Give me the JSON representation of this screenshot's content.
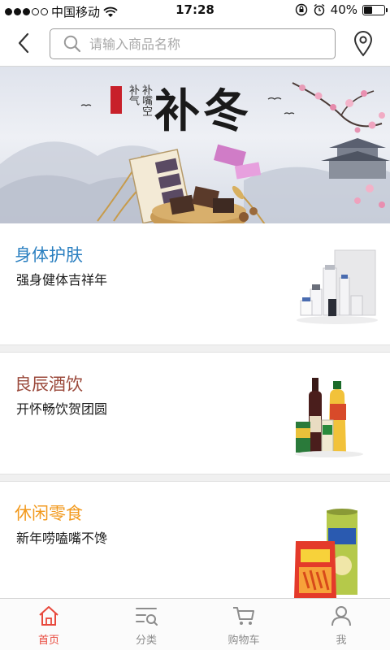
{
  "status_bar": {
    "carrier": "中国移动",
    "time": "17:28",
    "battery": "40%",
    "battery_level": 0.4
  },
  "header": {
    "search_placeholder": "请输入商品名称",
    "icons": [
      "back-arrow-icon",
      "search-icon",
      "location-pin-icon"
    ]
  },
  "banner": {
    "title": "补冬",
    "sub1": "补气",
    "sub2": "补嘴空"
  },
  "categories": [
    {
      "title": "身体护肤",
      "desc": "强身健体吉祥年",
      "color": "#2a7fc0"
    },
    {
      "title": "良辰酒饮",
      "desc": "开怀畅饮贺团圆",
      "color": "#9b4a3c"
    },
    {
      "title": "休闲零食",
      "desc": "新年唠嗑嘴不馋",
      "color": "#f29a1f"
    }
  ],
  "tabbar": {
    "items": [
      {
        "label": "首页",
        "icon": "home-icon"
      },
      {
        "label": "分类",
        "icon": "category-icon"
      },
      {
        "label": "购物车",
        "icon": "cart-icon"
      },
      {
        "label": "我",
        "icon": "user-icon"
      }
    ],
    "active_color": "#e8483c",
    "inactive_color": "#8c8c8c"
  }
}
